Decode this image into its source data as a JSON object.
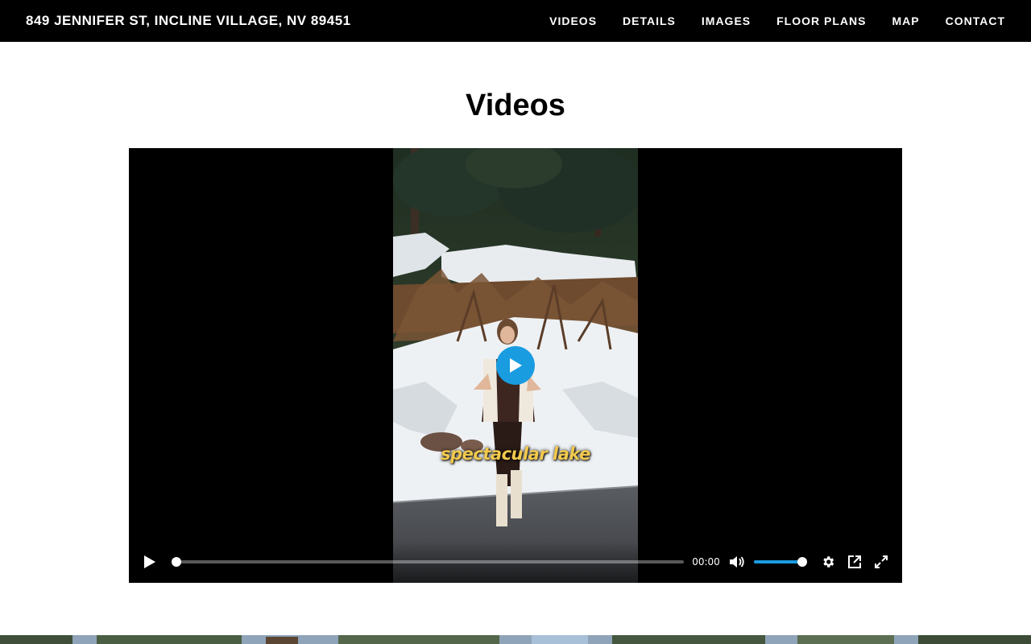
{
  "header": {
    "title": "849 JENNIFER ST, INCLINE VILLAGE, NV 89451",
    "nav": [
      "VIDEOS",
      "DETAILS",
      "IMAGES",
      "FLOOR PLANS",
      "MAP",
      "CONTACT"
    ]
  },
  "videos_section": {
    "title": "Videos"
  },
  "player": {
    "caption_overlay": "spectacular lake",
    "current_time": "00:00",
    "progress_fraction": 0.0,
    "volume_fraction": 1.0,
    "accent_color": "#1a9ce0",
    "icons": [
      "play-icon",
      "big-play-icon",
      "volume-icon",
      "settings-icon",
      "popout-icon",
      "fullscreen-icon"
    ]
  }
}
